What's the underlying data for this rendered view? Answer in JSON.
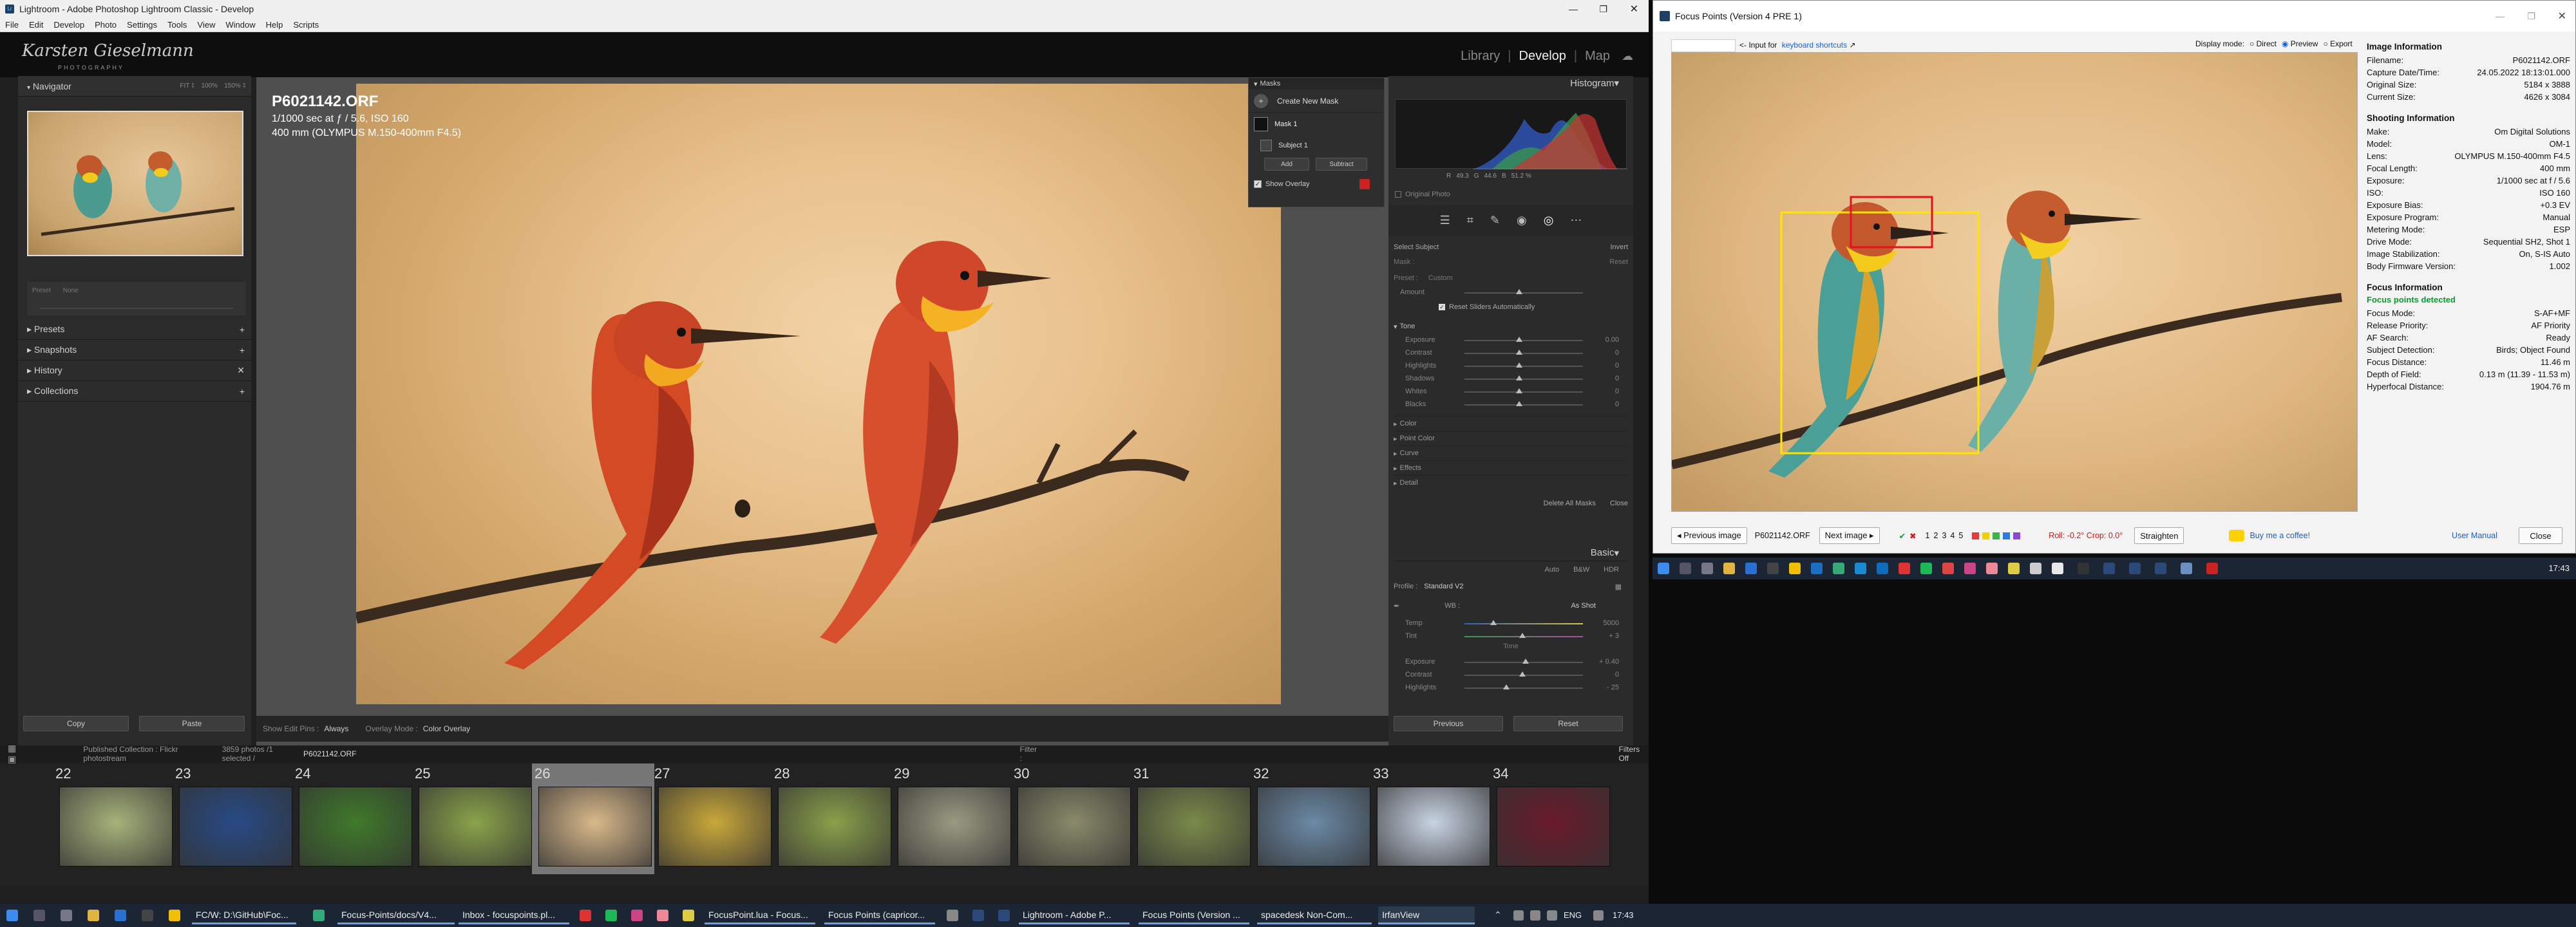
{
  "lightroom": {
    "window_title": "Lightroom - Adobe Photoshop Lightroom Classic - Develop",
    "menu": [
      "File",
      "Edit",
      "Develop",
      "Photo",
      "Settings",
      "Tools",
      "View",
      "Window",
      "Help",
      "Scripts"
    ],
    "identity_plate": {
      "name": "Karsten Gieselmann",
      "sub": "PHOTOGRAPHY"
    },
    "modules": [
      "Library",
      "Develop",
      "Map"
    ],
    "active_module": "Develop",
    "navigator": {
      "title": "Navigator",
      "zoom": [
        "FIT ‡",
        "100%",
        "150% ‡"
      ]
    },
    "left_panels": [
      "Presets",
      "Snapshots",
      "History",
      "Collections"
    ],
    "preset_amount": {
      "label": "Preset",
      "value": "None"
    },
    "image_overlay": {
      "name": "P6021142.ORF",
      "line1": "1/1000 sec at ƒ / 5.6, ISO 160",
      "line2": "400 mm (OLYMPUS M.150-400mm F4.5)"
    },
    "masks": {
      "title": "Masks",
      "create": "Create New Mask",
      "items": [
        "Mask 1",
        "Subject 1"
      ],
      "add": "Add",
      "subtract": "Subtract",
      "show_overlay": "Show Overlay"
    },
    "histogram": {
      "title": "Histogram",
      "readout": [
        "R",
        "49.3",
        "G",
        "44.6",
        "B",
        "51.2 %"
      ],
      "original_photo": "Original Photo"
    },
    "mask_panel": {
      "select_subject": "Select Subject",
      "invert": "Invert",
      "mask_label": "Mask :",
      "reset": "Reset",
      "preset_label": "Preset :",
      "preset_value": "Custom",
      "amount_label": "Amount",
      "reset_sliders": "Reset Sliders Automatically",
      "tone": "Tone",
      "sliders": [
        {
          "label": "Exposure",
          "value": "0.00"
        },
        {
          "label": "Contrast",
          "value": "0"
        },
        {
          "label": "Highlights",
          "value": "0"
        },
        {
          "label": "Shadows",
          "value": "0"
        },
        {
          "label": "Whites",
          "value": "0"
        },
        {
          "label": "Blacks",
          "value": "0"
        }
      ],
      "sections": [
        "Color",
        "Point Color",
        "Curve",
        "Effects",
        "Detail"
      ],
      "delete_all": "Delete All Masks",
      "close": "Close"
    },
    "basic": {
      "title": "Basic",
      "treatment": [
        "Auto",
        "B&W",
        "HDR"
      ],
      "profile_label": "Profile :",
      "profile_value": "Standard V2",
      "wb_label": "WB :",
      "wb_value": "As Shot",
      "temp": {
        "label": "Temp",
        "value": "5000"
      },
      "tint": {
        "label": "Tint",
        "value": "+ 3"
      },
      "tone_label": "Tone",
      "exposure": {
        "label": "Exposure",
        "value": "+ 0.40"
      },
      "contrast": {
        "label": "Contrast",
        "value": "0"
      },
      "highlights": {
        "label": "Highlights",
        "value": "- 25"
      }
    },
    "bottom_buttons": {
      "copy": "Copy",
      "paste": "Paste",
      "previous": "Previous",
      "reset": "Reset"
    },
    "toolbar": {
      "show_edit_pins": "Show Edit Pins :",
      "edit_pins_value": "Always",
      "overlay_mode": "Overlay Mode :",
      "overlay_value": "Color Overlay"
    },
    "filmstrip_header": {
      "collection": "Published Collection : Flickr photostream",
      "count": "3859 photos /1 selected /",
      "file": "P6021142.ORF",
      "filter": "Filter :",
      "filters_off": "Filters Off"
    },
    "thumb_numbers": [
      "22",
      "23",
      "24",
      "25",
      "26",
      "27",
      "28",
      "29",
      "30",
      "31",
      "32",
      "33",
      "34"
    ]
  },
  "focus_points": {
    "window_title": "Focus Points (Version 4 PRE 1)",
    "input_for": "<- Input for",
    "keyboard_shortcuts": "keyboard shortcuts",
    "display_mode_label": "Display mode:",
    "display_modes": [
      "Direct",
      "Preview",
      "Export"
    ],
    "selected_mode": "Preview",
    "image_information": {
      "title": "Image Information",
      "rows": [
        {
          "k": "Filename:",
          "v": "P6021142.ORF"
        },
        {
          "k": "Capture Date/Time:",
          "v": "24.05.2022 18:13:01.000"
        },
        {
          "k": "Original Size:",
          "v": "5184 x 3888"
        },
        {
          "k": "Current Size:",
          "v": "4626 x 3084"
        }
      ]
    },
    "shooting_information": {
      "title": "Shooting Information",
      "rows": [
        {
          "k": "Make:",
          "v": "Om Digital Solutions"
        },
        {
          "k": "Model:",
          "v": "OM-1"
        },
        {
          "k": "Lens:",
          "v": "OLYMPUS M.150-400mm F4.5"
        },
        {
          "k": "Focal Length:",
          "v": "400 mm"
        },
        {
          "k": "Exposure:",
          "v": "1/1000 sec at f / 5.6"
        },
        {
          "k": "ISO:",
          "v": "ISO 160"
        },
        {
          "k": "Exposure Bias:",
          "v": "+0.3 EV"
        },
        {
          "k": "Exposure Program:",
          "v": "Manual"
        },
        {
          "k": "Metering Mode:",
          "v": "ESP"
        },
        {
          "k": "Drive Mode:",
          "v": "Sequential SH2, Shot 1"
        },
        {
          "k": "Image Stabilization:",
          "v": "On, S-IS Auto"
        },
        {
          "k": "Body Firmware Version:",
          "v": "1.002"
        }
      ]
    },
    "focus_information": {
      "title": "Focus Information",
      "status": "Focus points detected",
      "rows": [
        {
          "k": "Focus Mode:",
          "v": "S-AF+MF"
        },
        {
          "k": "Release Priority:",
          "v": "AF Priority"
        },
        {
          "k": "AF Search:",
          "v": "Ready"
        },
        {
          "k": "Subject Detection:",
          "v": "Birds; Object Found"
        },
        {
          "k": "Focus Distance:",
          "v": "11.46 m"
        },
        {
          "k": "Depth of Field:",
          "v": "0.13 m (11.39 - 11.53 m)"
        },
        {
          "k": "Hyperfocal Distance:",
          "v": "1904.76 m"
        }
      ]
    },
    "footer": {
      "prev": "◂ Previous image",
      "filename": "P6021142.ORF",
      "next": "Next image ▸",
      "ratings": [
        "1",
        "2",
        "3",
        "4",
        "5"
      ],
      "roll_crop": "Roll: -0.2°  Crop: 0.0°",
      "straighten": "Straighten",
      "coffee": "Buy me a coffee!",
      "manual": "User Manual",
      "close": "Close"
    }
  },
  "taskbar": {
    "tasks": [
      "FC/W: D:\\GitHub\\Foc...",
      "Focus-Points/docs/V4...",
      "Inbox - focuspoints.pl...",
      "FocusPoint.lua - Focus...",
      "Focus Points (capricor...",
      "Lightroom - Adobe P...",
      "Focus Points (Version ...",
      "spacedesk Non-Com...",
      "IrfanView"
    ],
    "lang": "ENG",
    "time": "17:43"
  },
  "colors": {
    "accent": "#6aa0e8",
    "focus_yellow": "#ffe600",
    "focus_red": "#e8101a"
  }
}
